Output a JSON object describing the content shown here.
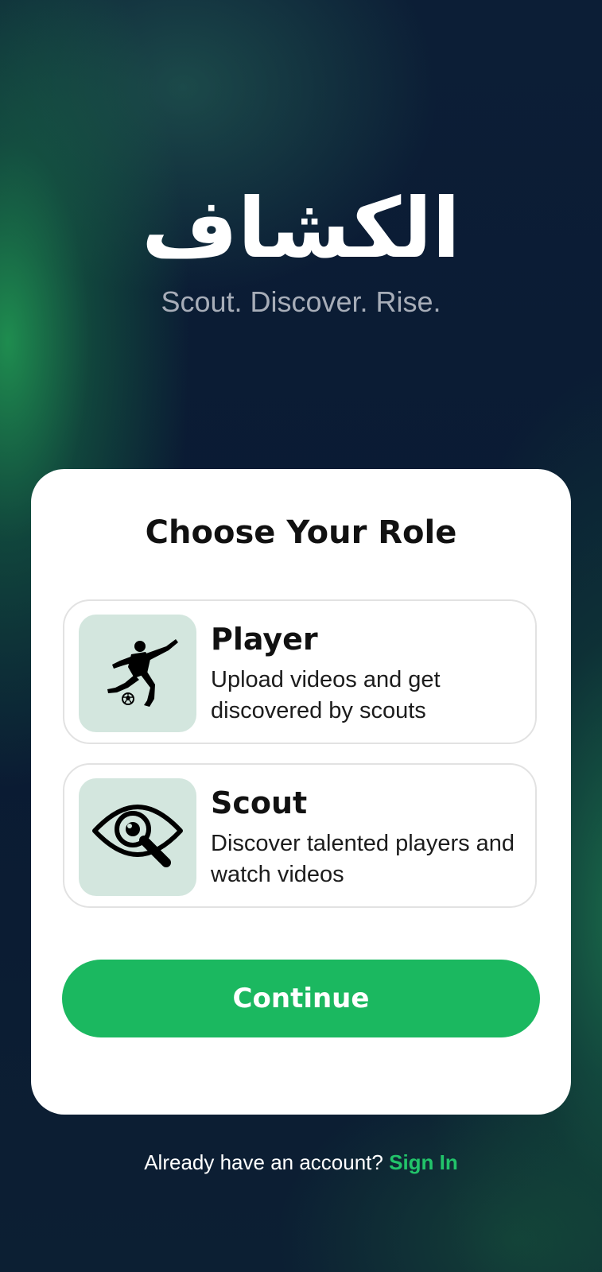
{
  "app": {
    "logo_text": "الكشاف",
    "tagline": "Scout. Discover. Rise."
  },
  "card": {
    "title": "Choose Your Role",
    "roles": [
      {
        "name": "Player",
        "description": "Upload videos and get discovered by scouts",
        "icon": "soccer-player-icon"
      },
      {
        "name": "Scout",
        "description": "Discover talented players and watch videos",
        "icon": "eye-magnifier-icon"
      }
    ],
    "continue_label": "Continue"
  },
  "footer": {
    "prompt": "Already have an account?",
    "signin_label": "Sign In"
  },
  "colors": {
    "accent": "#1bb860",
    "link": "#22c46a",
    "icon_bg": "#d3e6de",
    "background": "#0b1a34"
  }
}
